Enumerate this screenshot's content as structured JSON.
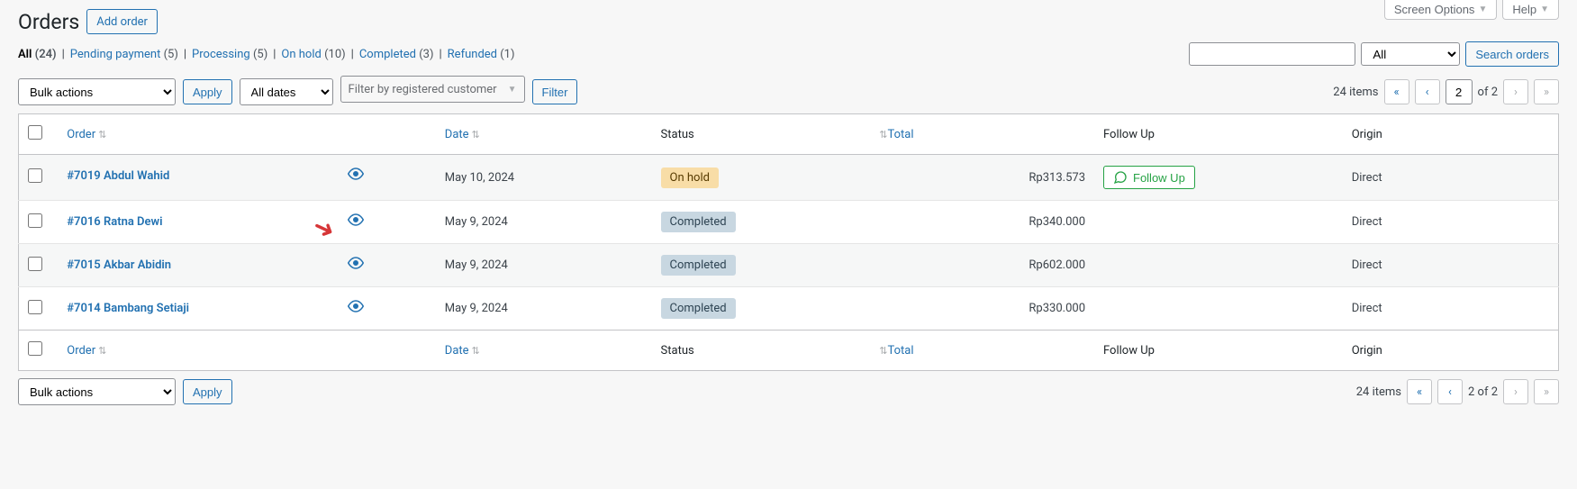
{
  "header": {
    "title": "Orders",
    "add_button": "Add order",
    "screen_options": "Screen Options",
    "help": "Help"
  },
  "status_filters": [
    {
      "label": "All",
      "count": "(24)",
      "current": true
    },
    {
      "label": "Pending payment",
      "count": "(5)"
    },
    {
      "label": "Processing",
      "count": "(5)"
    },
    {
      "label": "On hold",
      "count": "(10)"
    },
    {
      "label": "Completed",
      "count": "(3)"
    },
    {
      "label": "Refunded",
      "count": "(1)"
    }
  ],
  "search": {
    "category_all": "All",
    "search_button": "Search orders"
  },
  "bulk": {
    "bulk_actions": "Bulk actions",
    "apply": "Apply",
    "all_dates": "All dates",
    "customer_placeholder": "Filter by registered customer",
    "filter": "Filter"
  },
  "pagination": {
    "items_label": "24 items",
    "page_input": "2",
    "of_label": "of 2",
    "bottom_of": "2 of 2"
  },
  "columns": {
    "order": "Order",
    "date": "Date",
    "status": "Status",
    "total": "Total",
    "followup": "Follow Up",
    "origin": "Origin"
  },
  "followup_button": "Follow Up",
  "rows": [
    {
      "id": "#7019",
      "name": "Abdul Wahid",
      "date": "May 10, 2024",
      "status": "On hold",
      "status_class": "status-on-hold",
      "total": "Rp313.573",
      "followup": true,
      "origin": "Direct"
    },
    {
      "id": "#7016",
      "name": "Ratna Dewi",
      "date": "May 9, 2024",
      "status": "Completed",
      "status_class": "status-completed",
      "total": "Rp340.000",
      "followup": false,
      "origin": "Direct"
    },
    {
      "id": "#7015",
      "name": "Akbar Abidin",
      "date": "May 9, 2024",
      "status": "Completed",
      "status_class": "status-completed",
      "total": "Rp602.000",
      "followup": false,
      "origin": "Direct"
    },
    {
      "id": "#7014",
      "name": "Bambang Setiaji",
      "date": "May 9, 2024",
      "status": "Completed",
      "status_class": "status-completed",
      "total": "Rp330.000",
      "followup": false,
      "origin": "Direct"
    }
  ]
}
